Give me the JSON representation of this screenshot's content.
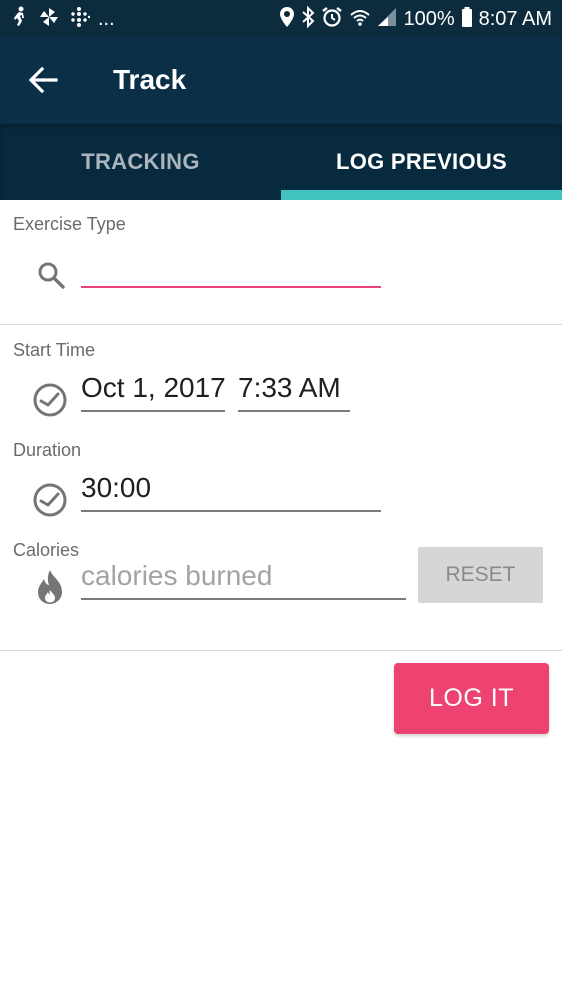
{
  "status_bar": {
    "left_overflow": "...",
    "battery_percent": "100%",
    "time": "8:07 AM"
  },
  "app_bar": {
    "title": "Track"
  },
  "tabs": [
    {
      "label": "TRACKING",
      "selected": false
    },
    {
      "label": "LOG PREVIOUS",
      "selected": true
    }
  ],
  "form": {
    "exercise_type": {
      "label": "Exercise Type",
      "value": ""
    },
    "start_time": {
      "label": "Start Time",
      "date": "Oct 1, 2017",
      "time": "7:33 AM"
    },
    "duration": {
      "label": "Duration",
      "value": "30:00"
    },
    "calories": {
      "label": "Calories",
      "placeholder": "calories burned",
      "reset_label": "RESET"
    }
  },
  "actions": {
    "log_label": "LOG IT"
  },
  "colors": {
    "status_bar": "#0c2c3e",
    "app_bar": "#0a2f46",
    "tab_bar": "#082a3e",
    "tab_indicator": "#3fc2c0",
    "accent_pink": "#ee4270",
    "reset_bg": "#d6d6d6"
  },
  "icons": [
    "fitbit-icon",
    "pinwheel-icon",
    "dots-grid-icon",
    "location-icon",
    "bluetooth-icon",
    "alarm-icon",
    "wifi-icon",
    "signal-icon",
    "battery-icon",
    "back-arrow-icon",
    "search-icon",
    "clock-icon",
    "flame-icon"
  ]
}
